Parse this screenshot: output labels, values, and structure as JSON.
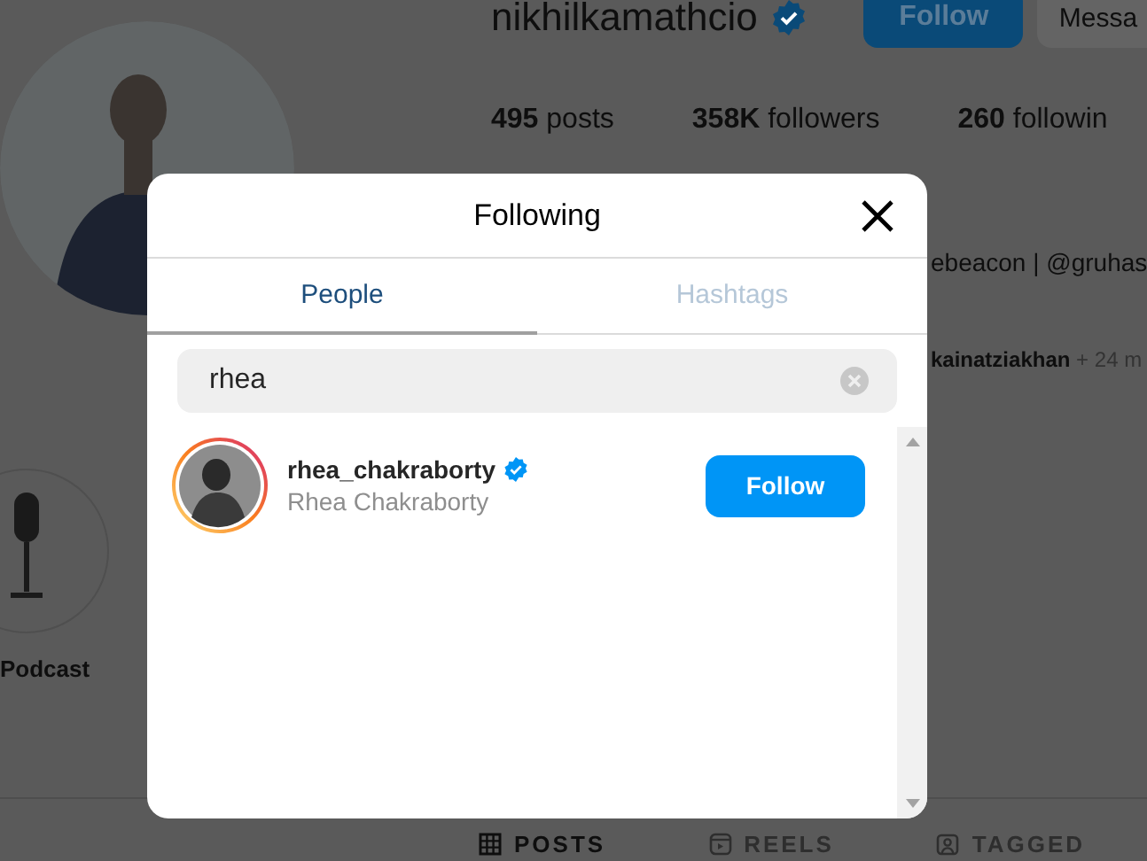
{
  "profile": {
    "username": "nikhilkamathcio",
    "verified": true,
    "buttons": [
      {
        "label": "Follow",
        "kind": "primary"
      },
      {
        "label": "Messa",
        "kind": "secondary"
      }
    ],
    "stats": [
      {
        "number": "495",
        "label": "posts"
      },
      {
        "number": "358K",
        "label": "followers"
      },
      {
        "number": "260",
        "label": "followin"
      }
    ],
    "bio": "ebeacon | @gruhas",
    "followed_by": {
      "name": "kainatziakhan",
      "more": "+ 24 m"
    },
    "highlights": [
      {
        "label": "Podcast"
      }
    ],
    "tabs": [
      {
        "label": "POSTS",
        "kind": "grid",
        "selected": true
      },
      {
        "label": "REELS",
        "kind": "reels",
        "selected": false
      },
      {
        "label": "TAGGED",
        "kind": "tagged",
        "selected": false
      }
    ]
  },
  "modal": {
    "title": "Following",
    "tabs": [
      {
        "label": "People",
        "selected": true
      },
      {
        "label": "Hashtags",
        "selected": false
      }
    ],
    "search": {
      "value": "rhea"
    },
    "results": [
      {
        "username": "rhea_chakraborty",
        "verified": true,
        "has_story": true,
        "full_name": "Rhea Chakraborty",
        "button": "Follow"
      }
    ]
  }
}
